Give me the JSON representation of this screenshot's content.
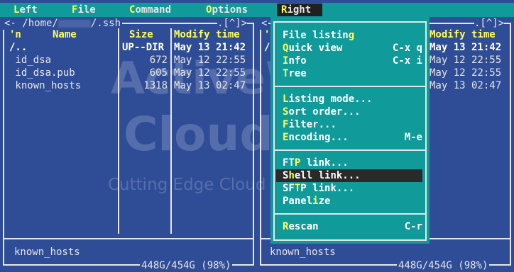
{
  "menubar": {
    "items": [
      {
        "hotkey": "L",
        "rest": "eft"
      },
      {
        "hotkey": "F",
        "rest": "ile"
      },
      {
        "hotkey": "C",
        "rest": "ommand"
      },
      {
        "hotkey": "O",
        "rest": "ptions"
      },
      {
        "hotkey": "R",
        "rest": "ight"
      }
    ]
  },
  "left_panel": {
    "path_prefix": "<- /home/",
    "path_suffix": "/.ssh",
    "path_right": ".[^]>",
    "headers": {
      "sort": "'n",
      "name": "Name",
      "size": "Size",
      "mtime": "Modify time"
    },
    "rows": [
      {
        "name": "/..",
        "size": "UP--DIR",
        "mtime": "May 13 21:42"
      },
      {
        "name": " id_dsa",
        "size": "672",
        "mtime": "May 12 22:55"
      },
      {
        "name": " id_dsa.pub",
        "size": "605",
        "mtime": "May 12 22:55"
      },
      {
        "name": " known_hosts",
        "size": "1318",
        "mtime": "May 13 02:47"
      }
    ],
    "mini_status": "known_hosts",
    "disk": "448G/454G (98%)"
  },
  "right_panel": {
    "path_left": "<",
    "path_right": ".[^]>",
    "header_mtime": "Modify time",
    "left_chars": [
      "'",
      "/"
    ],
    "mtimes": [
      "May 13 21:42",
      "May 12 22:55",
      "May 12 22:55",
      "May 13 02:47"
    ],
    "mini_status": "known_hosts",
    "disk": "448G/454G (98%)"
  },
  "right_menu": {
    "groups": [
      [
        {
          "pre": "File listin",
          "hk": "g",
          "post": "",
          "shortcut": ""
        },
        {
          "pre": "",
          "hk": "Q",
          "post": "uick view",
          "shortcut": "C-x q"
        },
        {
          "pre": "",
          "hk": "I",
          "post": "nfo",
          "shortcut": "C-x i"
        },
        {
          "pre": "",
          "hk": "T",
          "post": "ree",
          "shortcut": ""
        }
      ],
      [
        {
          "pre": "",
          "hk": "L",
          "post": "isting mode...",
          "shortcut": ""
        },
        {
          "pre": "",
          "hk": "S",
          "post": "ort order...",
          "shortcut": ""
        },
        {
          "pre": "",
          "hk": "F",
          "post": "ilter...",
          "shortcut": ""
        },
        {
          "pre": "",
          "hk": "E",
          "post": "ncoding...",
          "shortcut": "M-e"
        }
      ],
      [
        {
          "pre": "FT",
          "hk": "P",
          "post": " link...",
          "shortcut": ""
        },
        {
          "pre": "S",
          "hk": "h",
          "post": "ell link...",
          "shortcut": ""
        },
        {
          "pre": "SF",
          "hk": "T",
          "post": "P link...",
          "shortcut": ""
        },
        {
          "pre": "Panel",
          "hk": "i",
          "post": "ze",
          "shortcut": ""
        }
      ],
      [
        {
          "pre": "",
          "hk": "R",
          "post": "escan",
          "shortcut": "C-r"
        }
      ]
    ]
  },
  "watermark": {
    "line1": "ActiveWeb",
    "line2": "Cloud",
    "line3": "Cutting Edge Cloud Hosting"
  },
  "colors": {
    "panel_bg": "#2f4d97",
    "menu_bg": "#109a9a",
    "hotkey": "#ffff55",
    "selected_bg": "#2a2a2a"
  }
}
